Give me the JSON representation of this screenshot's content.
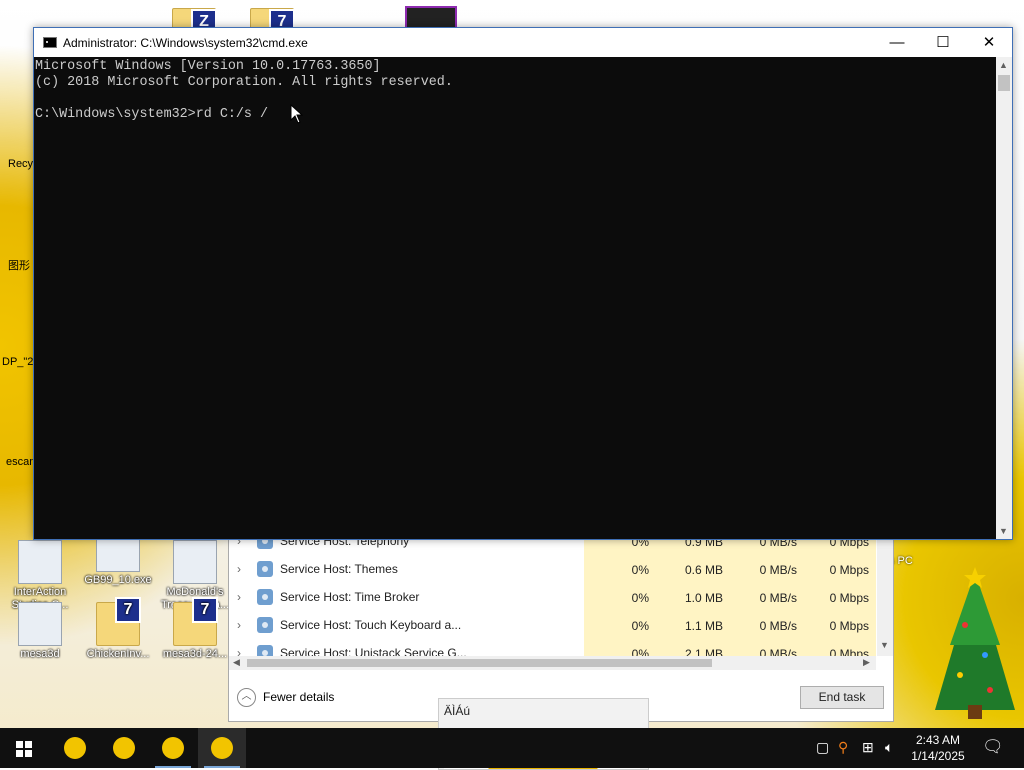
{
  "desktop": {
    "icons": [
      {
        "label": "InterAction Studios C..."
      },
      {
        "label": "GB99_10.exe"
      },
      {
        "label": "McDonald's Treasure La..."
      },
      {
        "label": "mesa3d"
      },
      {
        "label": "ChickenInv..."
      },
      {
        "label": "mesa3d-24..."
      }
    ],
    "partial_labels": {
      "recycle": "Recy",
      "chinese": "图形",
      "dp": "DP_\"2",
      "escan": "escan",
      "thispc": "s PC"
    }
  },
  "cmd": {
    "title": "Administrator: C:\\Windows\\system32\\cmd.exe",
    "lines": [
      "Microsoft Windows [Version 10.0.17763.3650]",
      "(c) 2018 Microsoft Corporation. All rights reserved.",
      "",
      "C:\\Windows\\system32>rd C:/s /"
    ],
    "controls": {
      "minimize": "—",
      "maximize": "☐",
      "close": "✕"
    }
  },
  "taskmgr": {
    "rows": [
      {
        "name": "Service Host: Telephony",
        "cpu": "0%",
        "memory": "0.9 MB",
        "disk": "0 MB/s",
        "network": "0 Mbps"
      },
      {
        "name": "Service Host: Themes",
        "cpu": "0%",
        "memory": "0.6 MB",
        "disk": "0 MB/s",
        "network": "0 Mbps"
      },
      {
        "name": "Service Host: Time Broker",
        "cpu": "0%",
        "memory": "1.0 MB",
        "disk": "0 MB/s",
        "network": "0 Mbps"
      },
      {
        "name": "Service Host: Touch Keyboard a...",
        "cpu": "0%",
        "memory": "1.1 MB",
        "disk": "0 MB/s",
        "network": "0 Mbps"
      },
      {
        "name": "Service Host: Unistack Service G...",
        "cpu": "0%",
        "memory": "2.1 MB",
        "disk": "0 MB/s",
        "network": "0 Mbps"
      }
    ],
    "fewer_details": "Fewer details",
    "end_task": "End task"
  },
  "thumbnail": {
    "title": "ÄÌÁú"
  },
  "taskbar": {
    "clock_time": "2:43 AM",
    "clock_date": "1/14/2025",
    "app_count_visible": 4,
    "active_app_index": 3
  },
  "colors": {
    "console_bg": "#0c0c0c",
    "console_fg": "#cccccc",
    "taskbar_bg": "#101010",
    "highlight_cell": "#fff4c4",
    "accent": "#7aa7d8"
  }
}
